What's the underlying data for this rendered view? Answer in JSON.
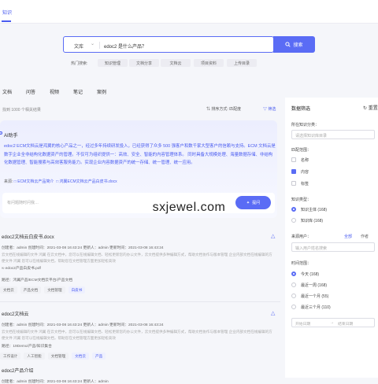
{
  "top": {
    "tab": "知识"
  },
  "search": {
    "scope": "文库",
    "query": "edoc2 是什么产品？",
    "button": "搜索"
  },
  "hot": {
    "label": "热门搜索:",
    "chips": [
      "知识管理",
      "文档分享",
      "文档云",
      "项目资料",
      "上传目录"
    ]
  },
  "tabs": [
    "文档",
    "问答",
    "视频",
    "笔记",
    "案例"
  ],
  "results": {
    "count": "找到 1000 个相关结果",
    "sort_label": "排序方式: 匹配度",
    "filter": "筛选"
  },
  "ai": {
    "title": "AI助手",
    "body": "edoc2 ECM文档云是鸿翼的核心产品之一，经过多年持续研发投入，已经获得了众多 500 强客户和数千家大型客户的信赖与支持。ECM 文档云是数字企业全非结构化数据资产的管理。不仅可为组织提供一：高效、安全、智能的内容管理体系。 同时具备大规模处理、海量数据存储、非结构化数据管理、智能搜索与高效客服务能力。实现企业内容数据资产的统一存储、统一管理、统一应用。",
    "src_label": "来源:",
    "src1": "ECM文档云产品简介",
    "src2": "鸿翼ECM文档云产品白皮书.docx",
    "ask_placeholder": "有问题随时问我…",
    "ask_button": "提问"
  },
  "docs": [
    {
      "title": "edoc2文档云白皮书.docx",
      "meta": "创建者：admin    创建时间：2021-03-08 16:43:24    更新人：admin    更新时间：2021-03-08 16:43:24",
      "snippet": "云文档在线编辑的文件 鸿翼 在云文档中，您可以在线编辑文档、轻松更新您的办公文件，云文档提供多种编辑方式，帮助文档协作与版本管理 企业内部文档在线编辑的方便文件 鸿翼 您可以在线编辑文档，帮助您在文档管理方面更加轻松高效",
      "attach": "edoc2产品白皮书.pdf",
      "path": "路径：鸿翼产品/ECM文档云平台/产品文档",
      "tags": [
        {
          "text": "文档云",
          "blue": false
        },
        {
          "text": "产品文档",
          "blue": false
        },
        {
          "text": "文档管理",
          "blue": false
        },
        {
          "text": "白皮书",
          "blue": true
        }
      ]
    },
    {
      "title": "edoc2文档云",
      "meta": "创建者：admin    创建时间：2021-03-08 16:43:24    更新人：admin    更新时间：2021-03-08 16:43:24",
      "snippet": "云文档在线编辑的文件 鸿翼 在云文档中，您可以在线编辑文档、轻松更新您的办公文件，云文档提供多种编辑方式，帮助文档协作与版本管理 企业内部文档在线编辑的方便文件 鸿翼 您可以在线编辑文档，帮助您在文档管理方面更加轻松高效",
      "path": "路径：19Demo/产品/知识集合",
      "tags": [
        {
          "text": "工作设计",
          "blue": false
        },
        {
          "text": "人工智能",
          "blue": false
        },
        {
          "text": "文档管理",
          "blue": false
        },
        {
          "text": "文档云",
          "blue": true
        },
        {
          "text": "产品",
          "blue": true
        }
      ]
    },
    {
      "title": "edoc2产品介绍",
      "meta": "创建者：admin    创建时间：2021-03-08 16:43:24    更新人：admin"
    }
  ],
  "filter": {
    "title": "数据筛选",
    "reset": "重置",
    "kb_label": "所在知识分类：",
    "kb_placeholder": "请选择知识库目录",
    "match_label": "匹配范围：",
    "match_opts": [
      {
        "text": "名称",
        "on": false
      },
      {
        "text": "内容",
        "on": true
      },
      {
        "text": "标签",
        "on": false
      }
    ],
    "type_label": "知识类型：",
    "type_opts": [
      {
        "text": "知识主体 (168)",
        "on": true
      },
      {
        "text": "知识库 (168)",
        "on": false
      }
    ],
    "user_label": "来源用户：",
    "user_all": "全部",
    "user_me": "作者",
    "user_placeholder": "输入用户姓名搜索",
    "time_label": "时间范围：",
    "time_opts": [
      {
        "text": "今天 (168)",
        "on": true
      },
      {
        "text": "最近一周 (168)",
        "on": false
      },
      {
        "text": "最近一个月 (55)",
        "on": false
      },
      {
        "text": "最近三个月 (110)",
        "on": false
      }
    ],
    "date_start": "开始日期",
    "date_arrow": "→",
    "date_end": "结束日期"
  },
  "watermark": "sxjewel.com"
}
